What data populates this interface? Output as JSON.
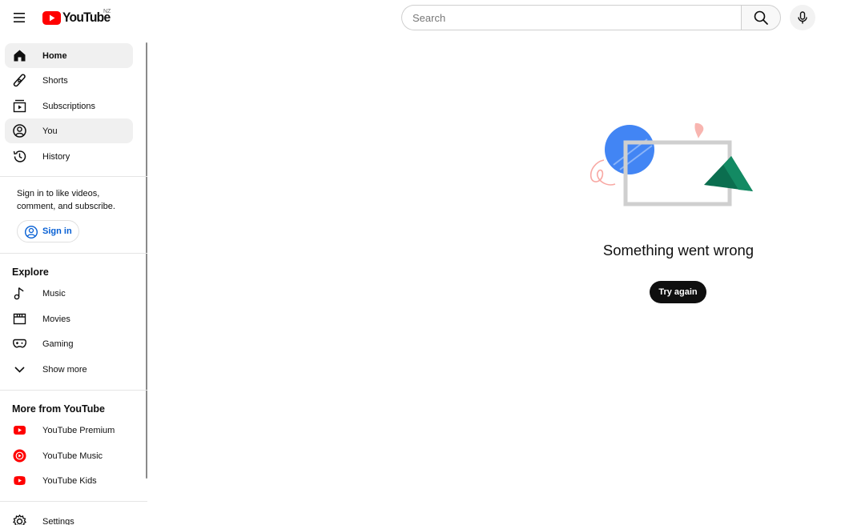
{
  "header": {
    "logo_text": "YouTube",
    "country_code": "NZ",
    "search_placeholder": "Search",
    "brand_color": "#ff0000"
  },
  "sidebar": {
    "main_items": [
      {
        "label": "Home",
        "icon": "home-icon",
        "active": true
      },
      {
        "label": "Shorts",
        "icon": "shorts-icon",
        "active": false
      },
      {
        "label": "Subscriptions",
        "icon": "subscriptions-icon",
        "active": false
      },
      {
        "label": "You",
        "icon": "you-icon",
        "active": true
      },
      {
        "label": "History",
        "icon": "history-icon",
        "active": false
      }
    ],
    "signin_prompt": "Sign in to like videos, comment, and subscribe.",
    "signin_button": "Sign in",
    "explore_title": "Explore",
    "explore_items": [
      {
        "label": "Music",
        "icon": "music-note-icon"
      },
      {
        "label": "Movies",
        "icon": "movies-icon"
      },
      {
        "label": "Gaming",
        "icon": "gaming-icon"
      },
      {
        "label": "Show more",
        "icon": "chevron-down-icon"
      }
    ],
    "more_title": "More from YouTube",
    "more_items": [
      {
        "label": "YouTube Premium",
        "icon": "youtube-premium-icon"
      },
      {
        "label": "YouTube Music",
        "icon": "youtube-music-icon"
      },
      {
        "label": "YouTube Kids",
        "icon": "youtube-kids-icon"
      }
    ],
    "settings_label": "Settings"
  },
  "main": {
    "error_message": "Something went wrong",
    "retry_button": "Try again"
  },
  "colors": {
    "accent_blue": "#065fd4",
    "illustration_blue": "#4285f4",
    "illustration_green": "#0b6e4f",
    "illustration_pink": "#f8b5b0"
  }
}
